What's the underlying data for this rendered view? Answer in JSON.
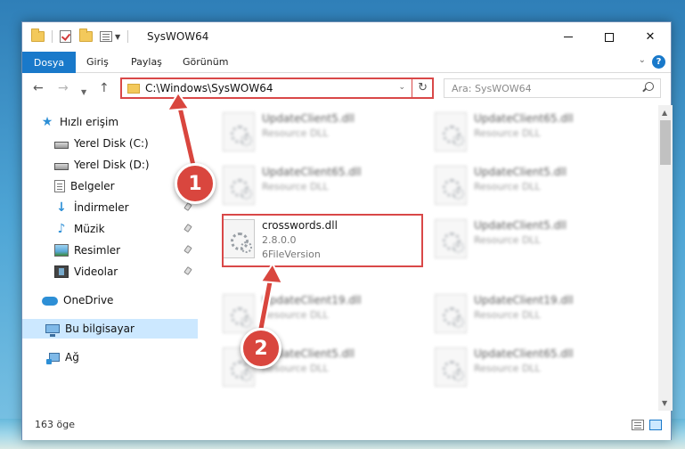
{
  "window": {
    "title": "SysWOW64",
    "controls": {
      "minimize": "—",
      "maximize": "☐",
      "close": "✕"
    }
  },
  "ribbon": {
    "tabs": [
      "Dosya",
      "Giriş",
      "Paylaş",
      "Görünüm"
    ],
    "help": "?"
  },
  "navigation": {
    "address_path": "C:\\Windows\\SysWOW64",
    "search_placeholder": "Ara: SysWOW64"
  },
  "sidebar": {
    "items": [
      {
        "label": "Hızlı erişim",
        "icon": "star-icon"
      },
      {
        "label": "Yerel Disk (C:)",
        "icon": "drive-icon"
      },
      {
        "label": "Yerel Disk (D:)",
        "icon": "drive-icon"
      },
      {
        "label": "Belgeler",
        "icon": "documents-icon"
      },
      {
        "label": "İndirmeler",
        "icon": "download-icon",
        "pinned": true
      },
      {
        "label": "Müzik",
        "icon": "music-icon",
        "pinned": true
      },
      {
        "label": "Resimler",
        "icon": "pictures-icon",
        "pinned": true
      },
      {
        "label": "Videolar",
        "icon": "videos-icon",
        "pinned": true
      },
      {
        "label": "OneDrive",
        "icon": "cloud-icon"
      },
      {
        "label": "Bu bilgisayar",
        "icon": "computer-icon",
        "selected": true
      },
      {
        "label": "Ağ",
        "icon": "network-icon"
      }
    ]
  },
  "files": [
    {
      "name": "UpdateClient5.dll",
      "type": "Resource DLL"
    },
    {
      "name": "UpdateClient65.dll",
      "type": "Resource DLL"
    },
    {
      "name": "UpdateClient65.dll",
      "type": "Resource DLL"
    },
    {
      "name": "UpdateClient5.dll",
      "type": "Resource DLL"
    },
    {
      "name": "UpdateClient5.dll",
      "type": "Resource DLL"
    },
    {
      "name": "UpdateClient19.dll",
      "type": "Resource DLL"
    },
    {
      "name": "UpdateClient19.dll",
      "type": "Resource DLL"
    },
    {
      "name": "UpdateClient5.dll",
      "type": "Resource DLL"
    },
    {
      "name": "UpdateClient65.dll",
      "type": "Resource DLL"
    }
  ],
  "highlighted_file": {
    "name": "crosswords.dll",
    "version": "2.8.0.0",
    "description": "6FileVersion"
  },
  "status": {
    "item_count": "163 öge"
  },
  "callouts": [
    "1",
    "2"
  ],
  "colors": {
    "accent": "#1979ca",
    "highlight": "#d94848",
    "selection": "#cce8ff"
  }
}
